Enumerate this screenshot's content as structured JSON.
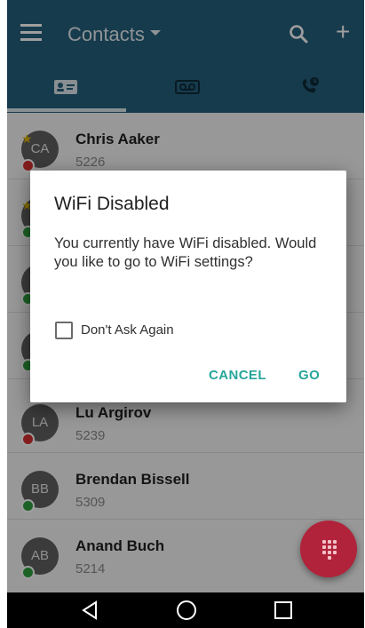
{
  "appbar": {
    "title": "Contacts",
    "add_symbol": "+"
  },
  "tabs": [
    {
      "name": "contacts-tab-icon"
    },
    {
      "name": "voicemail-tab-icon"
    },
    {
      "name": "call-history-tab-icon"
    }
  ],
  "contacts": [
    {
      "initials": "CA",
      "name": "Chris Aaker",
      "ext": "5226",
      "favorite": true,
      "status": "busy"
    },
    {
      "initials": "",
      "name": "",
      "ext": "",
      "favorite": true,
      "status": "available"
    },
    {
      "initials": "",
      "name": "",
      "ext": "",
      "favorite": false,
      "status": "available"
    },
    {
      "initials": "",
      "name": "",
      "ext": "",
      "favorite": false,
      "status": "available"
    },
    {
      "initials": "LA",
      "name": "Lu Argirov",
      "ext": "5239",
      "favorite": false,
      "status": "busy"
    },
    {
      "initials": "BB",
      "name": "Brendan Bissell",
      "ext": "5309",
      "favorite": false,
      "status": "available"
    },
    {
      "initials": "AB",
      "name": "Anand Buch",
      "ext": "5214",
      "favorite": false,
      "status": "available"
    }
  ],
  "dialog": {
    "title": "WiFi Disabled",
    "message": "You currently have WiFi disabled. Would you like to go to WiFi settings?",
    "checkbox_label": "Don't Ask Again",
    "cancel_label": "CANCEL",
    "go_label": "GO"
  },
  "colors": {
    "appbar": "#245f7c",
    "accent_button": "#26a69a",
    "fab": "#b1233a",
    "status_busy": "#d32f2f",
    "status_available": "#2e9e3e"
  }
}
